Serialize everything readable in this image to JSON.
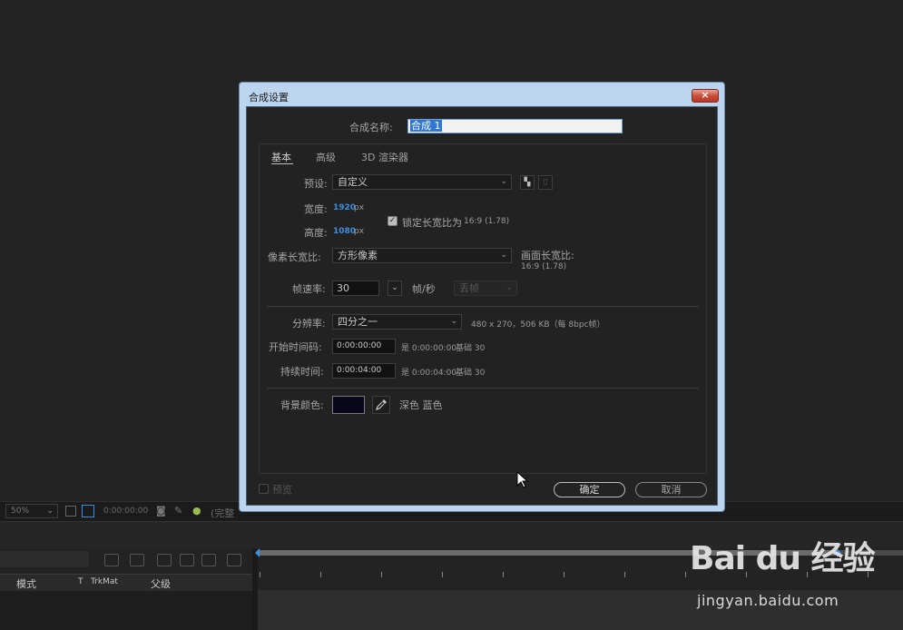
{
  "dialog": {
    "title": "合成设置",
    "close_label": "×",
    "comp_name_label": "合成名称:",
    "comp_name_value": "合成 1",
    "tabs": [
      "基本",
      "高级",
      "3D 渲染器"
    ],
    "preset_label": "预设:",
    "preset_value": "自定义",
    "width_label": "宽度:",
    "width_value": "1920",
    "width_unit": "px",
    "height_label": "高度:",
    "height_value": "1080",
    "height_unit": "px",
    "lock_label": "锁定长宽比为",
    "lock_ratio": "16:9 (1.78)",
    "lock_checked": true,
    "par_label": "像素长宽比:",
    "par_value": "方形像素",
    "frame_aspect_label": "画面长宽比:",
    "frame_aspect_value": "16:9 (1.78)",
    "fps_label": "帧速率:",
    "fps_value": "30",
    "fps_unit": "帧/秒",
    "drop_frame_value": "丢帧",
    "resolution_label": "分辨率:",
    "resolution_value": "四分之一",
    "resolution_info": "480 x 270，506 KB（每 8bpc帧）",
    "start_tc_label": "开始时间码:",
    "start_tc_value": "0:00:00:00",
    "start_tc_is": "是 0:00:00:00",
    "start_tc_base": "基础 30",
    "duration_label": "持续时间:",
    "duration_value": "0:00:04:00",
    "duration_is": "是 0:00:04:00",
    "duration_base": "基础 30",
    "bg_label": "背景颜色:",
    "bg_color": "#07061a",
    "bg_color_name": "深色 蓝色",
    "preview_label": "预览",
    "ok_label": "确定",
    "cancel_label": "取消"
  },
  "viewer_bar": {
    "zoom": "50%",
    "timecode": "0:00:00:00",
    "quality_partial": "(完整"
  },
  "timeline": {
    "columns": [
      "模式",
      "T",
      "TrkMat",
      "父级"
    ]
  },
  "watermark": {
    "logo": "Bai du 经验",
    "url": "jingyan.baidu.com"
  }
}
